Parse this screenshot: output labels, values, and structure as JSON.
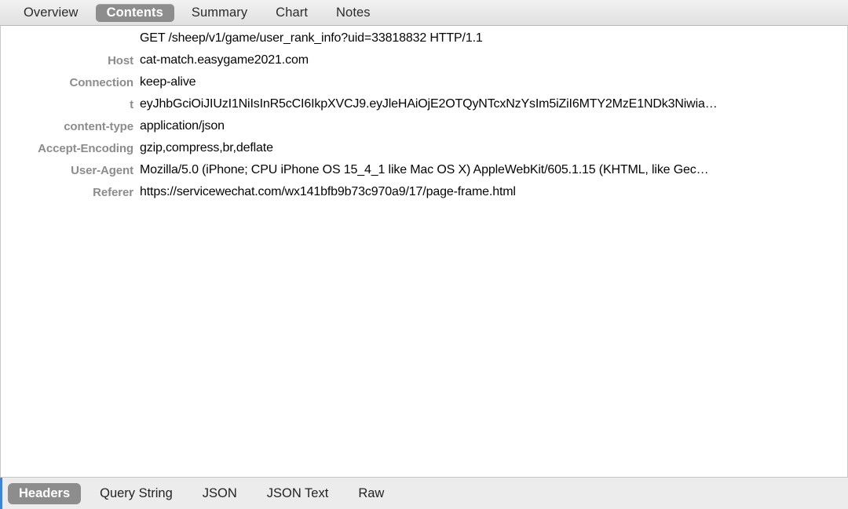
{
  "window": {
    "title": "Contents"
  },
  "top_tabs": [
    {
      "label": "Overview",
      "selected": false
    },
    {
      "label": "Contents",
      "selected": true
    },
    {
      "label": "Summary",
      "selected": false
    },
    {
      "label": "Chart",
      "selected": false
    },
    {
      "label": "Notes",
      "selected": false
    }
  ],
  "headers": [
    {
      "name": "",
      "value": "GET /sheep/v1/game/user_rank_info?uid=33818832 HTTP/1.1"
    },
    {
      "name": "Host",
      "value": "cat-match.easygame2021.com"
    },
    {
      "name": "Connection",
      "value": "keep-alive"
    },
    {
      "name": "t",
      "value": "eyJhbGciOiJIUzI1NiIsInR5cCI6IkpXVCJ9.eyJleHAiOjE2OTQyNTcxNzYsIm5iZiI6MTY2MzE1NDk3Niwia…"
    },
    {
      "name": "content-type",
      "value": "application/json"
    },
    {
      "name": "Accept-Encoding",
      "value": "gzip,compress,br,deflate"
    },
    {
      "name": "User-Agent",
      "value": "Mozilla/5.0 (iPhone; CPU iPhone OS 15_4_1 like Mac OS X) AppleWebKit/605.1.15 (KHTML, like Gec…"
    },
    {
      "name": "Referer",
      "value": "https://servicewechat.com/wx141bfb9b73c970a9/17/page-frame.html"
    }
  ],
  "bottom_tabs": [
    {
      "label": "Headers",
      "selected": true
    },
    {
      "label": "Query String",
      "selected": false
    },
    {
      "label": "JSON",
      "selected": false
    },
    {
      "label": "JSON Text",
      "selected": false
    },
    {
      "label": "Raw",
      "selected": false
    }
  ],
  "colors": {
    "selected_tab_bg": "#8d8d8d",
    "selected_tab_text": "#ffffff",
    "header_label": "#8c8c8c",
    "header_value": "#050505",
    "accent_blue": "#3b86d6",
    "toolbar_bg": "#e8e8e8",
    "bottom_bar_bg": "#ececec"
  }
}
